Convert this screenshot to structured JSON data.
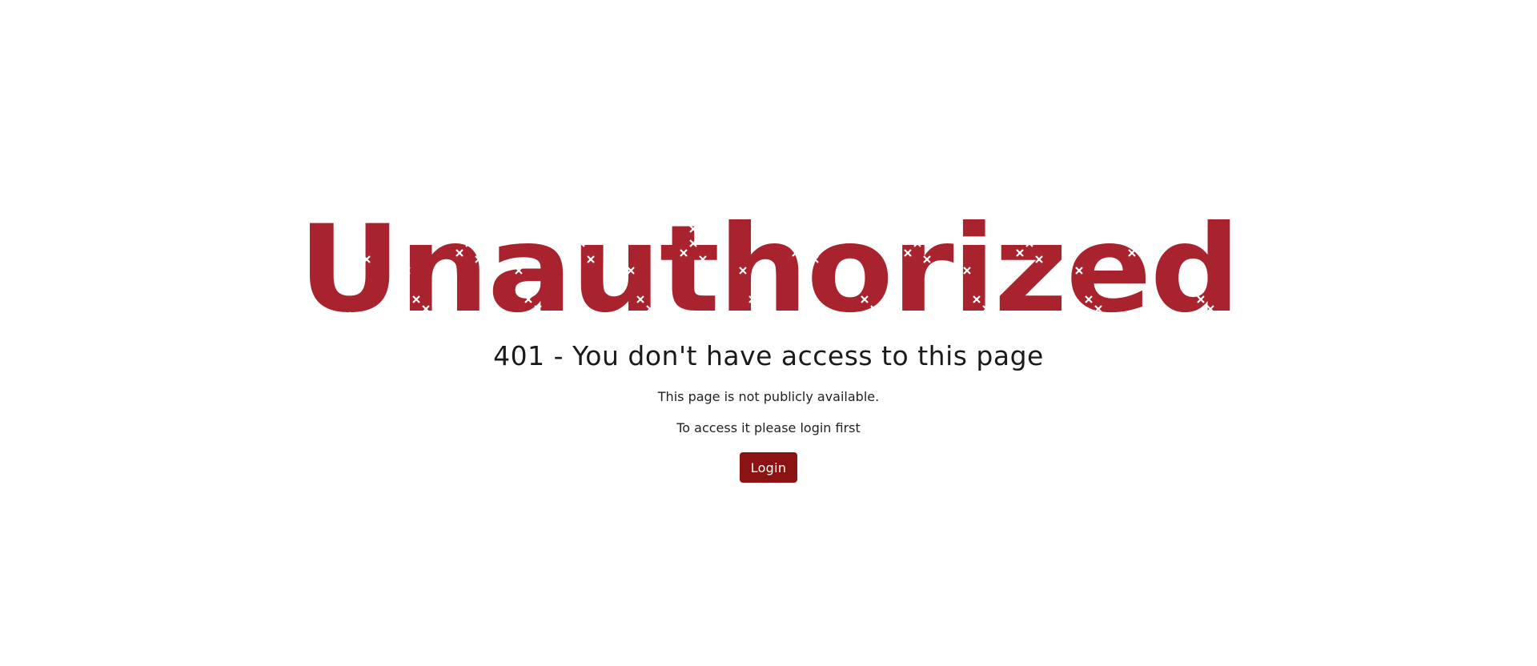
{
  "hero": {
    "title": "Unauthorized",
    "color": "#a9232f",
    "pattern_color": "#ffffff"
  },
  "error": {
    "heading": "401 - You don't have access to this page",
    "line1": "This page is not publicly available.",
    "line2": "To access it please login first"
  },
  "actions": {
    "login_label": "Login",
    "login_color": "#8b1313"
  }
}
